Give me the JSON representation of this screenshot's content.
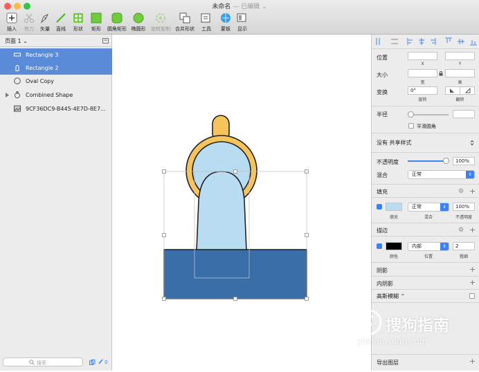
{
  "window": {
    "title": "未命名",
    "subtitle": "— 已编辑 ⌄"
  },
  "toolbar": {
    "insert": "插入",
    "scissors": "剪刀",
    "vector": "矢量",
    "line": "直线",
    "shape": "形状",
    "rect": "矩形",
    "round_rect": "圆角矩形",
    "oval": "椭圆形",
    "rotate_copy": "旋转复制",
    "combine": "合并形状",
    "tools": "工具",
    "template": "蒙板",
    "display": "显示"
  },
  "sidebar": {
    "page_selector": "页面 1 ⌄",
    "layers": [
      {
        "name": "Rectangle 3",
        "selected": true
      },
      {
        "name": "Rectangle 2",
        "selected": true
      },
      {
        "name": "Oval Copy",
        "selected": false
      },
      {
        "name": "Combined Shape",
        "selected": false
      },
      {
        "name": "9CF36DC9-B445-4E7D-8E7...",
        "selected": false
      }
    ],
    "search_placeholder": "搜索",
    "footer_count": "0"
  },
  "inspector": {
    "position": "位置",
    "x": "X",
    "y": "Y",
    "size": "大小",
    "width": "宽",
    "height": "高",
    "transform": "变换",
    "rotate_value": "0°",
    "rotate": "旋转",
    "flip": "翻转",
    "radius": "半径",
    "smooth_corners": "平滑圆角",
    "shared_style": "没有 共享样式",
    "opacity_label": "不透明度",
    "opacity_value": "100%",
    "blend_label": "混合",
    "blend_value": "正常",
    "fill_title": "填充",
    "fill_label": "填充",
    "fill_blend": "正常",
    "fill_blend_label": "混合",
    "fill_opacity": "100%",
    "fill_opacity_label": "不透明度",
    "border_title": "描边",
    "border_color_label": "颜色",
    "border_position": "内部",
    "border_position_label": "位置",
    "border_width": "2",
    "border_width_label": "粗细",
    "shadow": "阴影",
    "inner_shadow": "内阴影",
    "gaussian_blur": "高斯模糊 ⌃",
    "export": "导出图层"
  },
  "colors": {
    "fill_swatch": "#b8dcf2",
    "border_swatch": "#000000",
    "accent": "#3b82f6",
    "selection": "#5a8bd9",
    "shape_blue": "#3a6ea8",
    "shape_light": "#b8dcf2",
    "shape_yellow": "#f7c35c"
  },
  "watermark": {
    "brand": "搜狗指南",
    "url": "zhinan.sogo.com"
  }
}
